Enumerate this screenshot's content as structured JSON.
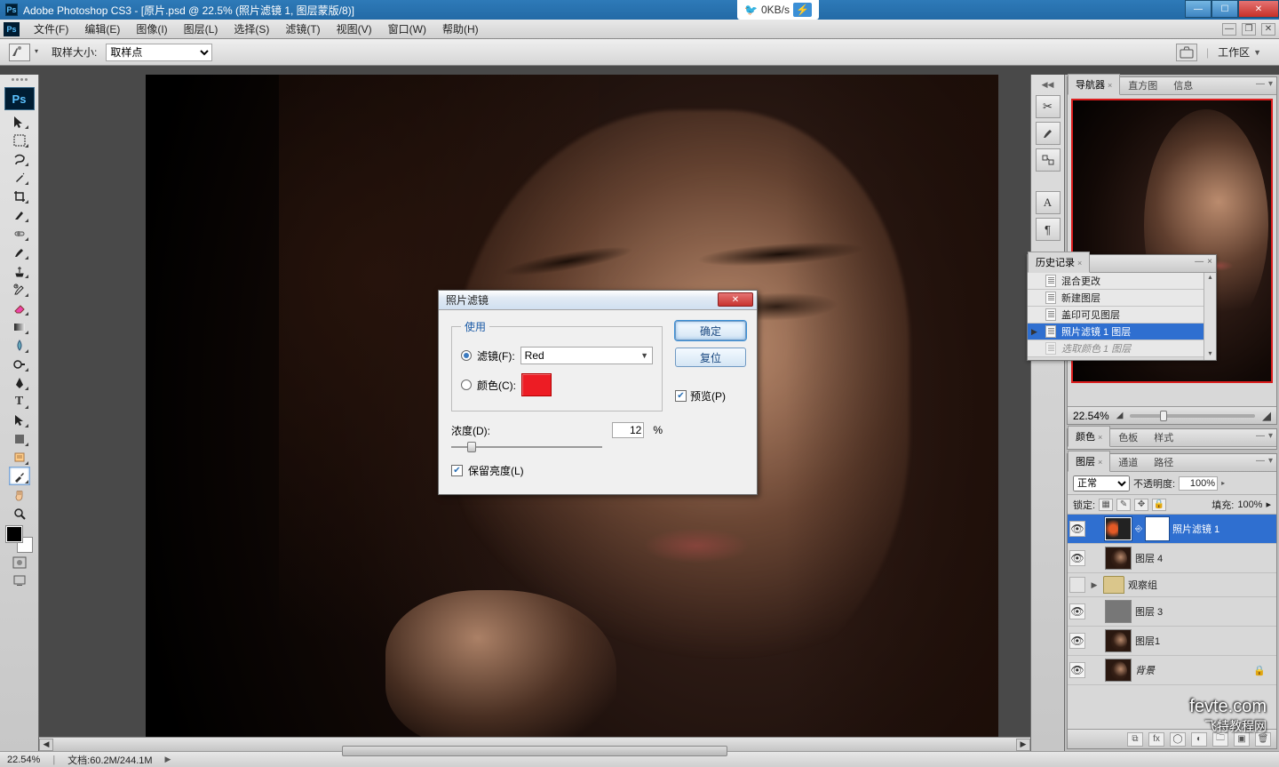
{
  "titlebar": {
    "app": "Adobe Photoshop CS3",
    "doc": "[原片.psd @ 22.5% (照片滤镜 1, 图层蒙版/8)]",
    "net_speed": "0KB/s"
  },
  "menus": {
    "file": "文件(F)",
    "edit": "编辑(E)",
    "image": "图像(I)",
    "layer": "图层(L)",
    "select": "选择(S)",
    "filter": "滤镜(T)",
    "view": "视图(V)",
    "window": "窗口(W)",
    "help": "帮助(H)"
  },
  "options": {
    "sample_size_label": "取样大小:",
    "sample_size_value": "取样点",
    "workspace_label": "工作区"
  },
  "status": {
    "zoom": "22.54%",
    "doc_size": "文档:60.2M/244.1M"
  },
  "dialog": {
    "title": "照片滤镜",
    "use_legend": "使用",
    "filter_label": "滤镜(F):",
    "filter_value": "Red",
    "color_label": "颜色(C):",
    "color_hex": "#ed1c24",
    "density_label": "浓度(D):",
    "density_value": "12",
    "density_unit": "%",
    "preserve_label": "保留亮度(L)",
    "ok": "确定",
    "reset": "复位",
    "preview": "预览(P)"
  },
  "navigator": {
    "tab_nav": "导航器",
    "tab_histogram": "直方图",
    "tab_info": "信息",
    "zoom": "22.54%"
  },
  "history": {
    "tab": "历史记录",
    "items": [
      {
        "label": "混合更改",
        "sel": false
      },
      {
        "label": "新建图层",
        "sel": false
      },
      {
        "label": "盖印可见图层",
        "sel": false
      },
      {
        "label": "照片滤镜 1 图层",
        "sel": true
      },
      {
        "label": "选取颜色 1 图层",
        "sel": false,
        "dim": true
      }
    ]
  },
  "color_panel": {
    "tab_color": "颜色",
    "tab_swatches": "色板",
    "tab_styles": "样式"
  },
  "layers_panel": {
    "tab_layers": "图层",
    "tab_channels": "通道",
    "tab_paths": "路径",
    "blend": "正常",
    "opacity_label": "不透明度:",
    "opacity": "100%",
    "lock_label": "锁定:",
    "fill_label": "填充:",
    "fill": "100%",
    "layers": [
      {
        "name": "照片滤镜 1",
        "type": "adjustment",
        "sel": true
      },
      {
        "name": "图层 4",
        "type": "pixel"
      },
      {
        "name": "观察组",
        "type": "group"
      },
      {
        "name": "图层 3",
        "type": "pixel_gray"
      },
      {
        "name": "图层1",
        "type": "pixel"
      },
      {
        "name": "背景",
        "type": "pixel",
        "locked": true,
        "italic": true
      }
    ]
  },
  "watermark": {
    "line1": "fevte.com",
    "line2": "飞特教程网"
  }
}
